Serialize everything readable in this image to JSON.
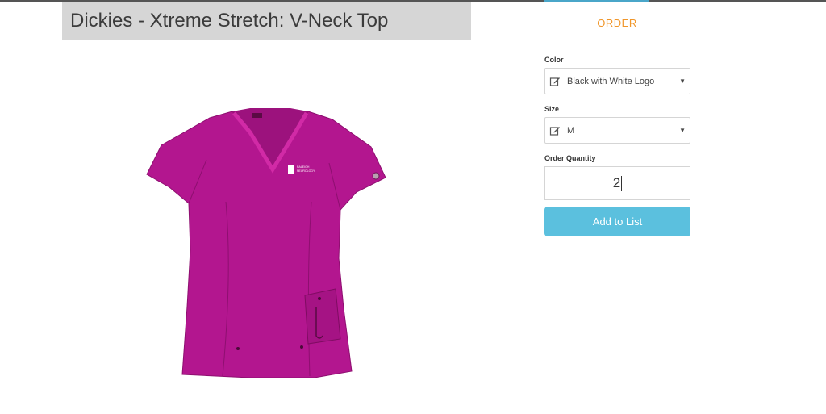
{
  "product": {
    "title": "Dickies - Xtreme Stretch: V-Neck Top",
    "image_icon": "v-neck-scrub-top",
    "garment_color": "#b3168f",
    "logo_text": [
      "RALEIGH",
      "NEUROLOGY"
    ]
  },
  "order_tab": {
    "label": "ORDER",
    "color": "#f0962a"
  },
  "form": {
    "color_label": "Color",
    "color_value": "Black with White Logo",
    "size_label": "Size",
    "size_value": "M",
    "quantity_label": "Order Quantity",
    "quantity_value": "2",
    "add_button_label": "Add to List",
    "button_color": "#5bc0de"
  }
}
